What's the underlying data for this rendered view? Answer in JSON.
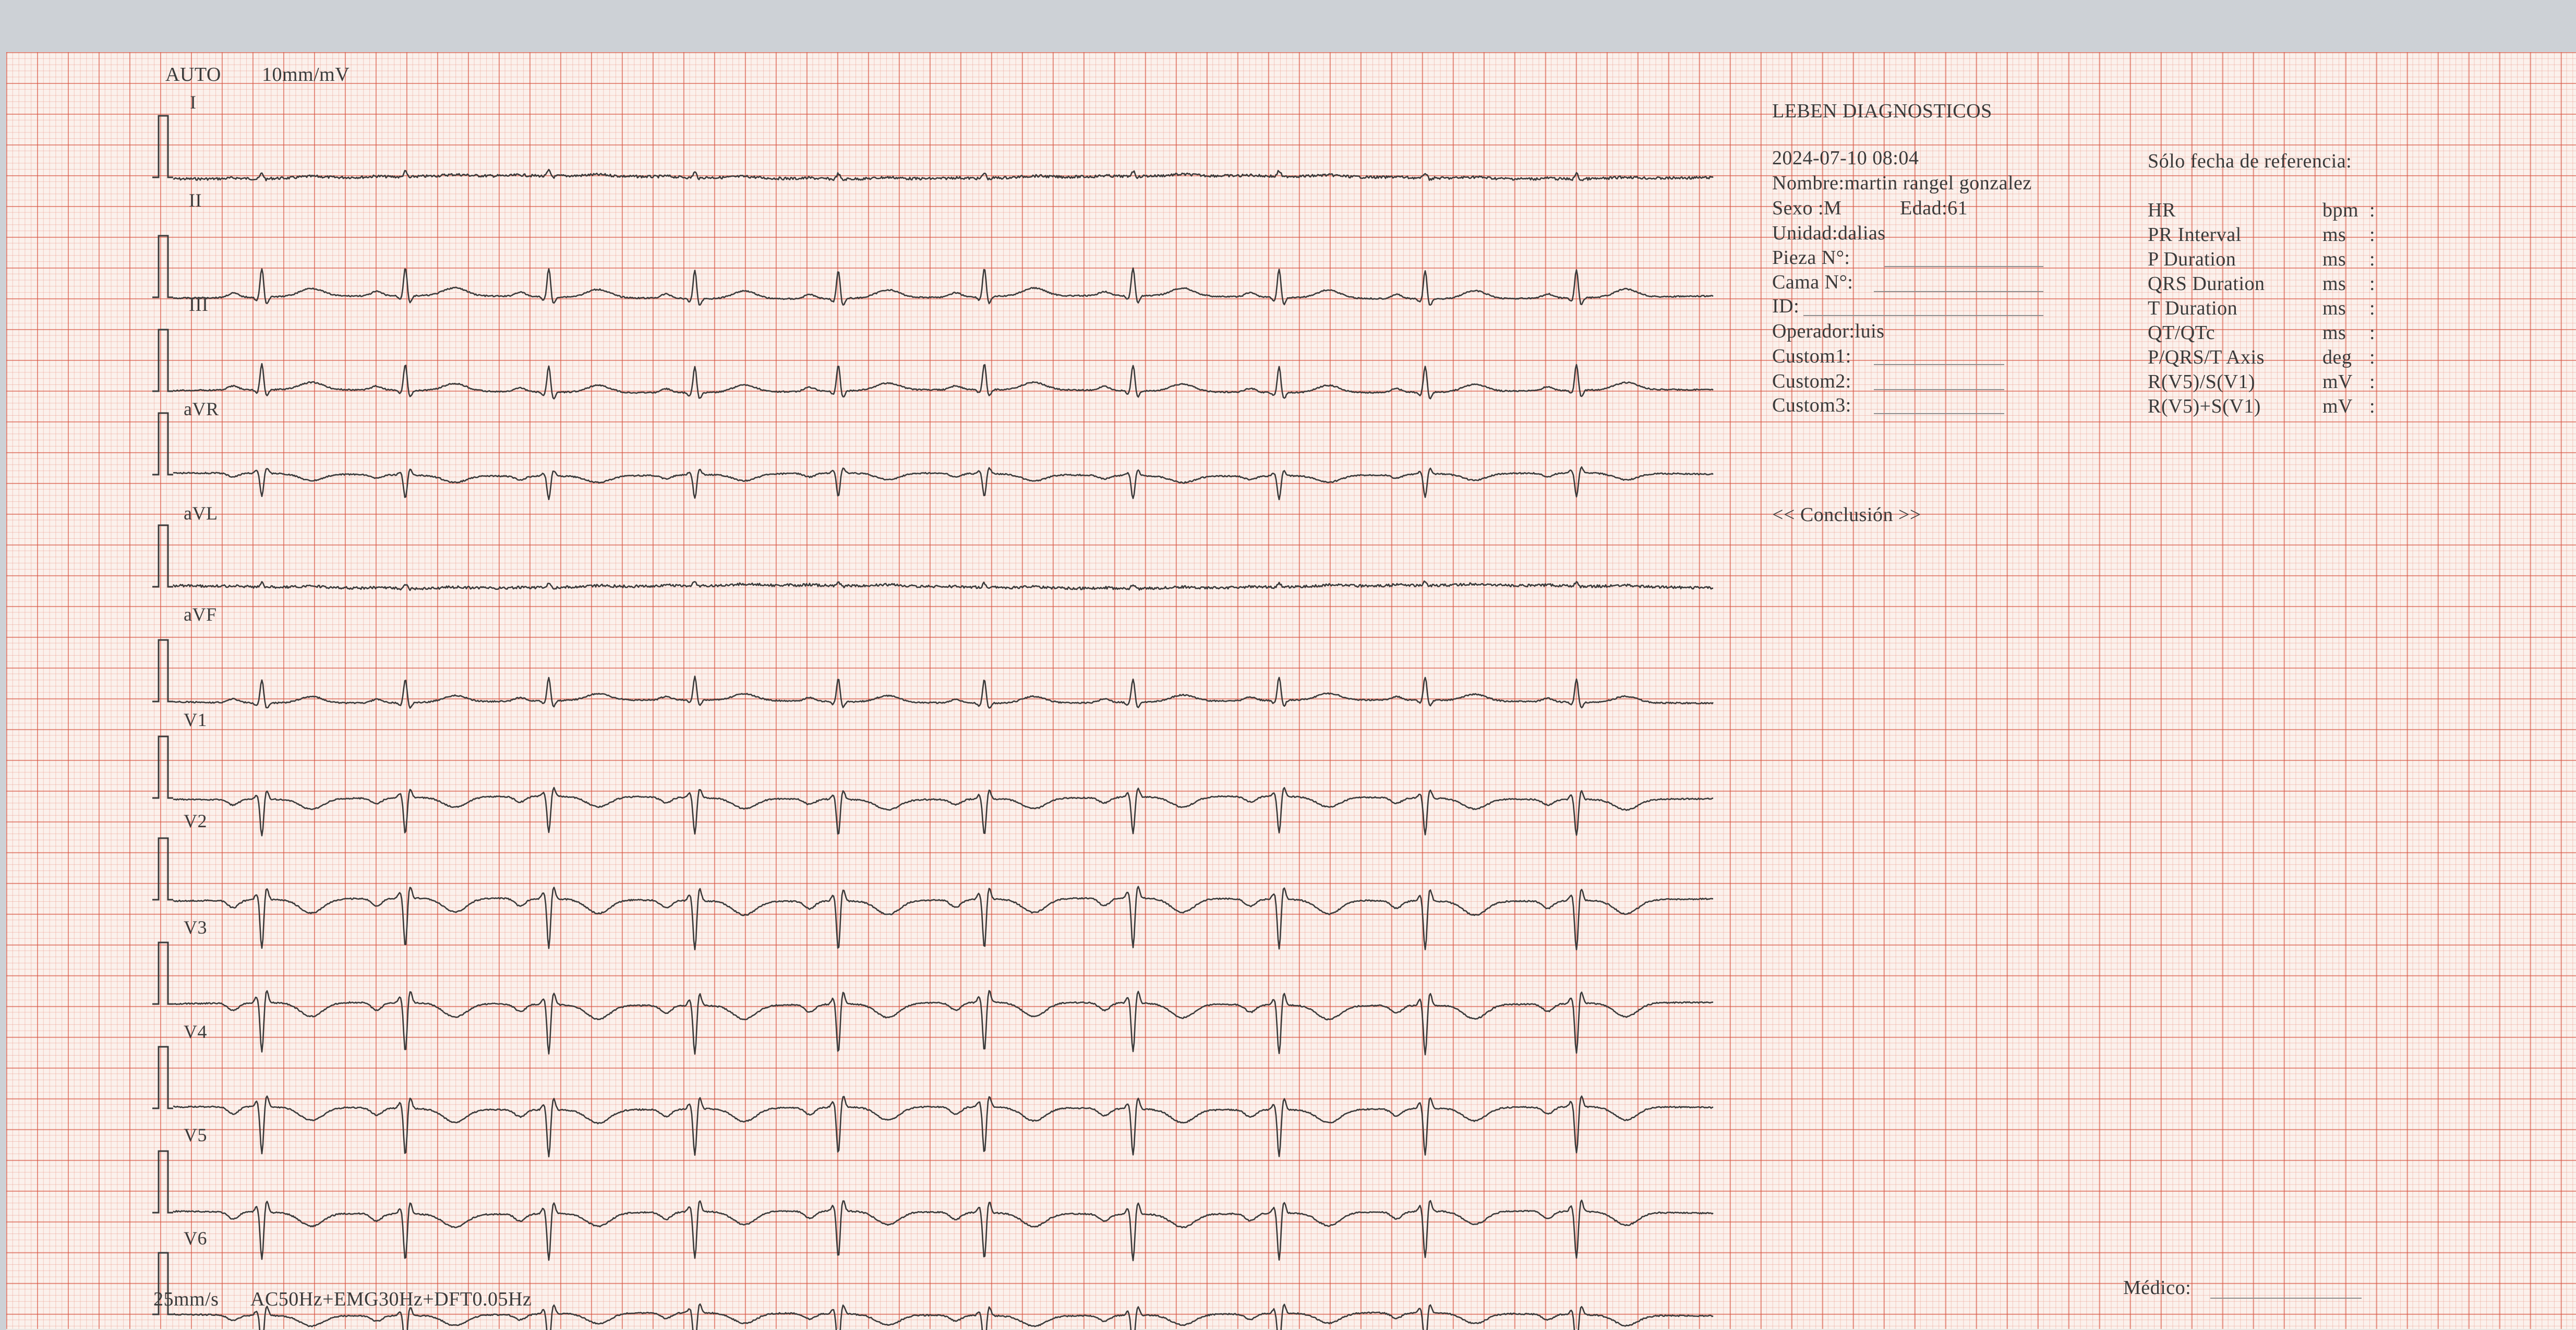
{
  "header": {
    "mode": "AUTO",
    "gain": "10mm/mV"
  },
  "leads": [
    {
      "label": "I",
      "baseline": 240,
      "amp": 10
    },
    {
      "label": "II",
      "baseline": 470,
      "amp": 55
    },
    {
      "label": "III",
      "baseline": 650,
      "amp": 50
    },
    {
      "label": "aVR",
      "baseline": 810,
      "amp": -45
    },
    {
      "label": "aVL",
      "baseline": 1025,
      "amp": 8
    },
    {
      "label": "aVF",
      "baseline": 1245,
      "amp": 45
    },
    {
      "label": "V1",
      "baseline": 1430,
      "amp": -70
    },
    {
      "label": "V2",
      "baseline": 1625,
      "amp": -95
    },
    {
      "label": "V3",
      "baseline": 1825,
      "amp": -95
    },
    {
      "label": "V4",
      "baseline": 2025,
      "amp": -90
    },
    {
      "label": "V5",
      "baseline": 2225,
      "amp": -90
    },
    {
      "label": "V6",
      "baseline": 2420,
      "amp": -70
    }
  ],
  "footer": {
    "speed": "25mm/s",
    "filters": "AC50Hz+EMG30Hz+DFT0.05Hz",
    "medico_label": "Médico:"
  },
  "patient": {
    "institution": "LEBEN DIAGNOSTICOS",
    "datetime": "2024-07-10 08:04",
    "nombre": "Nombre:martin rangel gonzalez",
    "sexo": "Sexo :M",
    "edad": "Edad:61",
    "unidad": "Unidad:dalias",
    "pieza": "Pieza N°:",
    "cama": "Cama N°:",
    "id": "ID:",
    "operador": "Operador:luis",
    "custom1": "Custom1:",
    "custom2": "Custom2:",
    "custom3": "Custom3:",
    "conclusion": "<< Conclusión >>"
  },
  "measurements": {
    "title": "Sólo fecha de referencia:",
    "rows": [
      {
        "name": "HR",
        "unit": "bpm",
        "sep": ":"
      },
      {
        "name": "PR Interval",
        "unit": "ms",
        "sep": ":"
      },
      {
        "name": "P Duration",
        "unit": "ms",
        "sep": ":"
      },
      {
        "name": "QRS Duration",
        "unit": "ms",
        "sep": ":"
      },
      {
        "name": "T Duration",
        "unit": "ms",
        "sep": ":"
      },
      {
        "name": "QT/QTc",
        "unit": "ms",
        "sep": ":"
      },
      {
        "name": "P/QRS/T Axis",
        "unit": "deg",
        "sep": ":"
      },
      {
        "name": "R(V5)/S(V1)",
        "unit": "mV",
        "sep": ":"
      },
      {
        "name": "R(V5)+S(V1)",
        "unit": "mV",
        "sep": ":"
      }
    ]
  }
}
